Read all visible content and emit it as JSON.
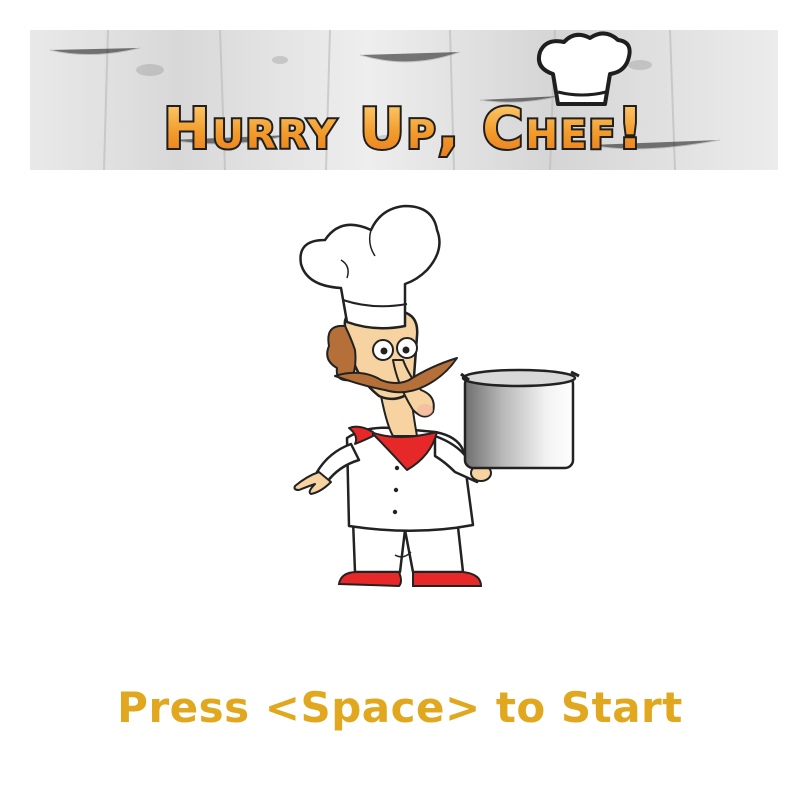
{
  "game": {
    "title": "Hurry Up, Chef!",
    "start_prompt": "Press <Space> to Start"
  },
  "colors": {
    "title_fill": "#f29b2a",
    "title_fill_light": "#ffd27a",
    "title_outline": "#1f1f1f",
    "prompt_text": "#e1a81f",
    "background": "#ffffff",
    "scarf": "#e62828",
    "shoes": "#e62828",
    "skin": "#f6d3a0",
    "hair": "#b5703a",
    "pot_light": "#f4f4f4",
    "pot_dark": "#7a7a7a"
  },
  "icons": {
    "banner_background": "distressed-wood-texture",
    "hat_logo": "chef-hat-icon",
    "mascot": "chef-character-holding-pot"
  }
}
